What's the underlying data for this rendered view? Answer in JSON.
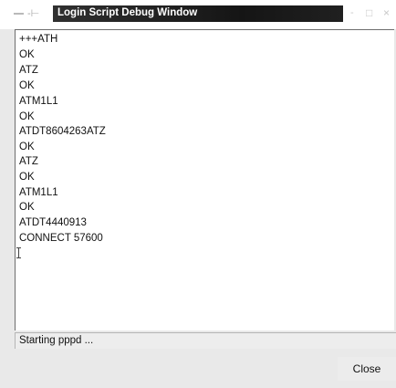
{
  "window": {
    "title": "Login Script Debug Window",
    "controls": {
      "pin": "-⊢",
      "minimize": "-",
      "maximize": "□",
      "close": "×"
    }
  },
  "log": {
    "lines": [
      "+++ATH",
      "OK",
      "ATZ",
      "OK",
      "ATM1L1",
      "OK",
      "ATDT8604263ATZ",
      "OK",
      "ATZ",
      "OK",
      "ATM1L1",
      "OK",
      "ATDT4440913",
      "CONNECT 57600"
    ]
  },
  "status": {
    "text": "Starting pppd ..."
  },
  "buttons": {
    "close_label": "Close"
  }
}
